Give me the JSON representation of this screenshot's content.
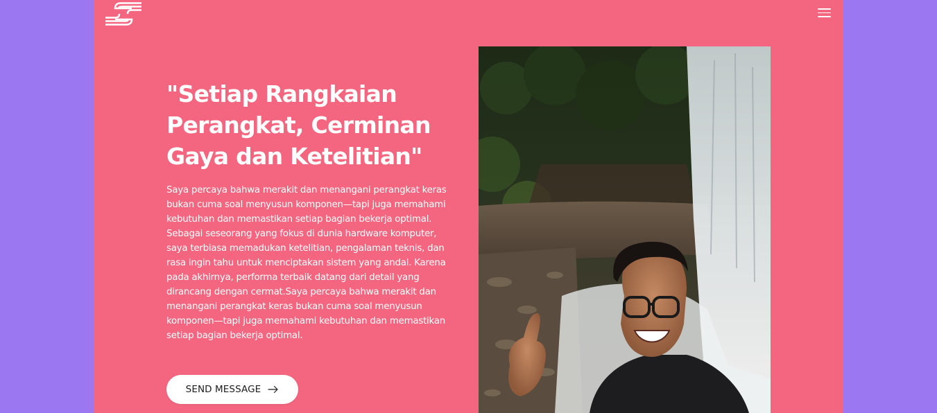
{
  "header": {
    "logo_icon": "brand-logo-icon",
    "menu_icon": "hamburger-menu-icon"
  },
  "hero": {
    "headline": "\"Setiap Rangkaian Perangkat, Cerminan Gaya dan Ketelitian\"",
    "bio": "Saya percaya bahwa merakit dan menangani perangkat keras bukan cuma soal menyusun komponen—tapi juga memahami kebutuhan dan memastikan setiap bagian bekerja optimal. Sebagai seseorang yang fokus di dunia hardware komputer, saya terbiasa memadukan ketelitian, pengalaman teknis, dan rasa ingin tahu untuk menciptakan sistem yang andal. Karena pada akhirnya, performa terbaik datang dari detail yang dirancang dengan cermat.Saya percaya bahwa merakit dan menangani perangkat keras bukan cuma soal menyusun komponen—tapi juga memahami kebutuhan dan memastikan setiap bagian bekerja optimal.",
    "cta_label": "SEND MESSAGE",
    "cta_icon": "arrow-right-icon"
  },
  "colors": {
    "outer_background": "#9b78f2",
    "page_background": "#f4667f",
    "text": "#ffffff",
    "button_background": "#ffffff",
    "button_text": "#1c1c1c"
  }
}
